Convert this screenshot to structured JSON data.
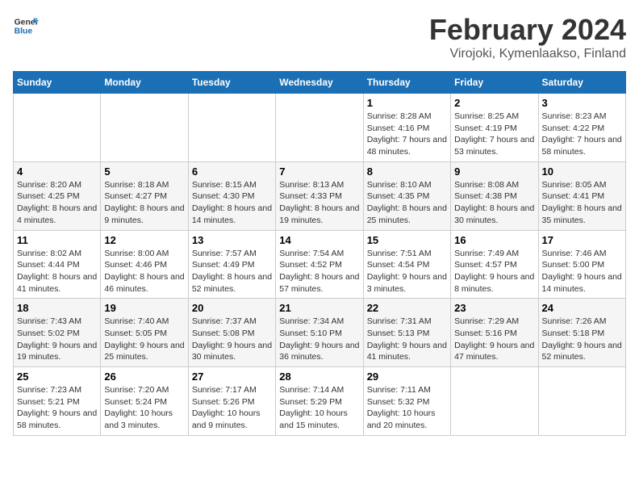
{
  "header": {
    "logo_line1": "General",
    "logo_line2": "Blue",
    "month_year": "February 2024",
    "location": "Virojoki, Kymenlaakso, Finland"
  },
  "weekdays": [
    "Sunday",
    "Monday",
    "Tuesday",
    "Wednesday",
    "Thursday",
    "Friday",
    "Saturday"
  ],
  "weeks": [
    [
      {
        "day": "",
        "sunrise": "",
        "sunset": "",
        "daylight": ""
      },
      {
        "day": "",
        "sunrise": "",
        "sunset": "",
        "daylight": ""
      },
      {
        "day": "",
        "sunrise": "",
        "sunset": "",
        "daylight": ""
      },
      {
        "day": "",
        "sunrise": "",
        "sunset": "",
        "daylight": ""
      },
      {
        "day": "1",
        "sunrise": "Sunrise: 8:28 AM",
        "sunset": "Sunset: 4:16 PM",
        "daylight": "Daylight: 7 hours and 48 minutes."
      },
      {
        "day": "2",
        "sunrise": "Sunrise: 8:25 AM",
        "sunset": "Sunset: 4:19 PM",
        "daylight": "Daylight: 7 hours and 53 minutes."
      },
      {
        "day": "3",
        "sunrise": "Sunrise: 8:23 AM",
        "sunset": "Sunset: 4:22 PM",
        "daylight": "Daylight: 7 hours and 58 minutes."
      }
    ],
    [
      {
        "day": "4",
        "sunrise": "Sunrise: 8:20 AM",
        "sunset": "Sunset: 4:25 PM",
        "daylight": "Daylight: 8 hours and 4 minutes."
      },
      {
        "day": "5",
        "sunrise": "Sunrise: 8:18 AM",
        "sunset": "Sunset: 4:27 PM",
        "daylight": "Daylight: 8 hours and 9 minutes."
      },
      {
        "day": "6",
        "sunrise": "Sunrise: 8:15 AM",
        "sunset": "Sunset: 4:30 PM",
        "daylight": "Daylight: 8 hours and 14 minutes."
      },
      {
        "day": "7",
        "sunrise": "Sunrise: 8:13 AM",
        "sunset": "Sunset: 4:33 PM",
        "daylight": "Daylight: 8 hours and 19 minutes."
      },
      {
        "day": "8",
        "sunrise": "Sunrise: 8:10 AM",
        "sunset": "Sunset: 4:35 PM",
        "daylight": "Daylight: 8 hours and 25 minutes."
      },
      {
        "day": "9",
        "sunrise": "Sunrise: 8:08 AM",
        "sunset": "Sunset: 4:38 PM",
        "daylight": "Daylight: 8 hours and 30 minutes."
      },
      {
        "day": "10",
        "sunrise": "Sunrise: 8:05 AM",
        "sunset": "Sunset: 4:41 PM",
        "daylight": "Daylight: 8 hours and 35 minutes."
      }
    ],
    [
      {
        "day": "11",
        "sunrise": "Sunrise: 8:02 AM",
        "sunset": "Sunset: 4:44 PM",
        "daylight": "Daylight: 8 hours and 41 minutes."
      },
      {
        "day": "12",
        "sunrise": "Sunrise: 8:00 AM",
        "sunset": "Sunset: 4:46 PM",
        "daylight": "Daylight: 8 hours and 46 minutes."
      },
      {
        "day": "13",
        "sunrise": "Sunrise: 7:57 AM",
        "sunset": "Sunset: 4:49 PM",
        "daylight": "Daylight: 8 hours and 52 minutes."
      },
      {
        "day": "14",
        "sunrise": "Sunrise: 7:54 AM",
        "sunset": "Sunset: 4:52 PM",
        "daylight": "Daylight: 8 hours and 57 minutes."
      },
      {
        "day": "15",
        "sunrise": "Sunrise: 7:51 AM",
        "sunset": "Sunset: 4:54 PM",
        "daylight": "Daylight: 9 hours and 3 minutes."
      },
      {
        "day": "16",
        "sunrise": "Sunrise: 7:49 AM",
        "sunset": "Sunset: 4:57 PM",
        "daylight": "Daylight: 9 hours and 8 minutes."
      },
      {
        "day": "17",
        "sunrise": "Sunrise: 7:46 AM",
        "sunset": "Sunset: 5:00 PM",
        "daylight": "Daylight: 9 hours and 14 minutes."
      }
    ],
    [
      {
        "day": "18",
        "sunrise": "Sunrise: 7:43 AM",
        "sunset": "Sunset: 5:02 PM",
        "daylight": "Daylight: 9 hours and 19 minutes."
      },
      {
        "day": "19",
        "sunrise": "Sunrise: 7:40 AM",
        "sunset": "Sunset: 5:05 PM",
        "daylight": "Daylight: 9 hours and 25 minutes."
      },
      {
        "day": "20",
        "sunrise": "Sunrise: 7:37 AM",
        "sunset": "Sunset: 5:08 PM",
        "daylight": "Daylight: 9 hours and 30 minutes."
      },
      {
        "day": "21",
        "sunrise": "Sunrise: 7:34 AM",
        "sunset": "Sunset: 5:10 PM",
        "daylight": "Daylight: 9 hours and 36 minutes."
      },
      {
        "day": "22",
        "sunrise": "Sunrise: 7:31 AM",
        "sunset": "Sunset: 5:13 PM",
        "daylight": "Daylight: 9 hours and 41 minutes."
      },
      {
        "day": "23",
        "sunrise": "Sunrise: 7:29 AM",
        "sunset": "Sunset: 5:16 PM",
        "daylight": "Daylight: 9 hours and 47 minutes."
      },
      {
        "day": "24",
        "sunrise": "Sunrise: 7:26 AM",
        "sunset": "Sunset: 5:18 PM",
        "daylight": "Daylight: 9 hours and 52 minutes."
      }
    ],
    [
      {
        "day": "25",
        "sunrise": "Sunrise: 7:23 AM",
        "sunset": "Sunset: 5:21 PM",
        "daylight": "Daylight: 9 hours and 58 minutes."
      },
      {
        "day": "26",
        "sunrise": "Sunrise: 7:20 AM",
        "sunset": "Sunset: 5:24 PM",
        "daylight": "Daylight: 10 hours and 3 minutes."
      },
      {
        "day": "27",
        "sunrise": "Sunrise: 7:17 AM",
        "sunset": "Sunset: 5:26 PM",
        "daylight": "Daylight: 10 hours and 9 minutes."
      },
      {
        "day": "28",
        "sunrise": "Sunrise: 7:14 AM",
        "sunset": "Sunset: 5:29 PM",
        "daylight": "Daylight: 10 hours and 15 minutes."
      },
      {
        "day": "29",
        "sunrise": "Sunrise: 7:11 AM",
        "sunset": "Sunset: 5:32 PM",
        "daylight": "Daylight: 10 hours and 20 minutes."
      },
      {
        "day": "",
        "sunrise": "",
        "sunset": "",
        "daylight": ""
      },
      {
        "day": "",
        "sunrise": "",
        "sunset": "",
        "daylight": ""
      }
    ]
  ]
}
